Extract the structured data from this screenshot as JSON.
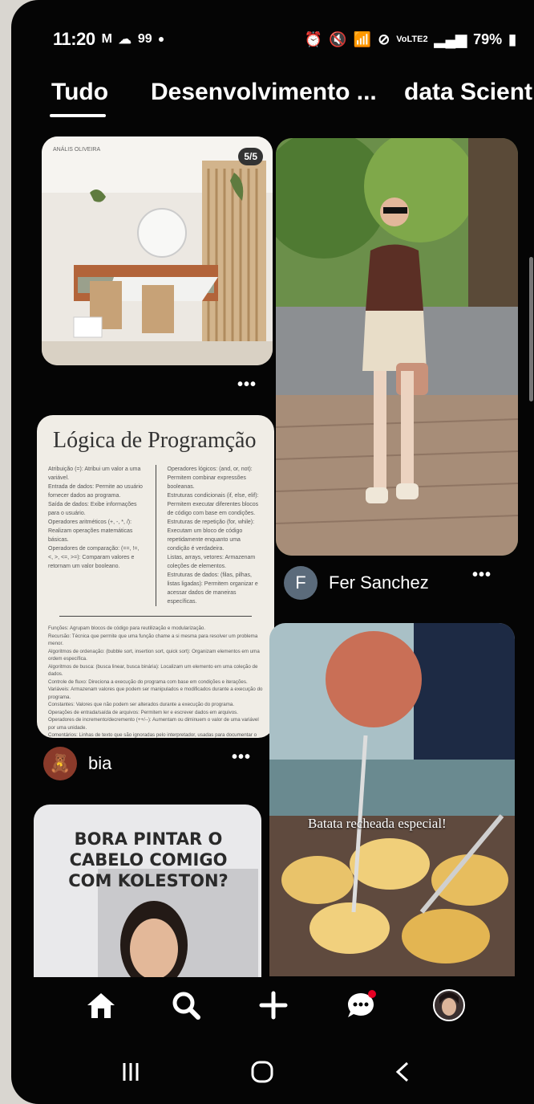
{
  "status_bar": {
    "time": "11:20",
    "notification_count": "99",
    "battery": "79%",
    "network_label": "VoLTE2"
  },
  "tabs": [
    {
      "label": "Tudo",
      "active": true
    },
    {
      "label": "Desenvolvimento ...",
      "active": false
    },
    {
      "label": "data Scient",
      "active": false
    }
  ],
  "pins": {
    "interior": {
      "badge": "5/5",
      "brand": "ANÁLIS OLIVEIRA"
    },
    "outfit": {
      "author": "Fer Sanchez",
      "author_initial": "F"
    },
    "logic": {
      "title": "Lógica de Programção",
      "author": "bia",
      "col1": [
        "Atribuição (=): Atribui um valor a uma variável.",
        "Entrada de dados: Permite ao usuário fornecer dados ao programa.",
        "Saída de dados: Exibe informações para o usuário.",
        "Operadores aritméticos (+, -, *, /): Realizam operações matemáticas básicas.",
        "Operadores de comparação: (==, !=, <, >, <=, >=): Comparam valores e retornam um valor booleano."
      ],
      "col2": [
        "Operadores lógicos: (and, or, not): Permitem combinar expressões booleanas.",
        "Estruturas condicionais (if, else, elif): Permitem executar diferentes blocos de código com base em condições.",
        "Estruturas de repetição (for, while): Executam um bloco de código repetidamente enquanto uma condição é verdadeira.",
        "Listas, arrays, vetores: Armazenam coleções de elementos.",
        "Estruturas de dados: (filas, pilhas, listas ligadas): Permitem organizar e acessar dados de maneiras específicas."
      ],
      "foot": [
        "Funções: Agrupam blocos de código para reutilização e modularização.",
        "Recursão: Técnica que permite que uma função chame a si mesma para resolver um problema menor.",
        "Algoritmos de ordenação: (bubble sort, insertion sort, quick sort): Organizam elementos em uma ordem específica.",
        "Algoritmos de busca: (busca linear, busca binária): Localizam um elemento em uma coleção de dados.",
        "Controle de fluxo: Direciona a execução do programa com base em condições e iterações.",
        "Variáveis: Armazenam valores que podem ser manipulados e modificados durante a execução do programa.",
        "Constantes: Valores que não podem ser alterados durante a execução do programa.",
        "Operações de entrada/saída de arquivos: Permitem ler e escrever dados em arquivos.",
        "Operadores de incremento/decremento (++/--): Aumentam ou diminuem o valor de uma variável por uma unidade.",
        "Comentários: Linhas de texto que são ignoradas pelo interpretador, usadas para documentar o código."
      ]
    },
    "hair": {
      "caption": "BORA PINTAR O CABELO COMIGO COM KOLESTON?"
    },
    "food": {
      "caption": "Batata recheada especial!"
    }
  },
  "bottom_nav": [
    {
      "icon": "home-icon",
      "active": true
    },
    {
      "icon": "search-icon",
      "active": false
    },
    {
      "icon": "plus-icon",
      "active": false
    },
    {
      "icon": "chat-icon",
      "active": false,
      "has_badge": true
    },
    {
      "icon": "profile-icon",
      "active": false
    }
  ],
  "more_glyph": "•••",
  "colors": {
    "background": "#050505",
    "accent_red": "#e60023",
    "text": "#ffffff"
  }
}
